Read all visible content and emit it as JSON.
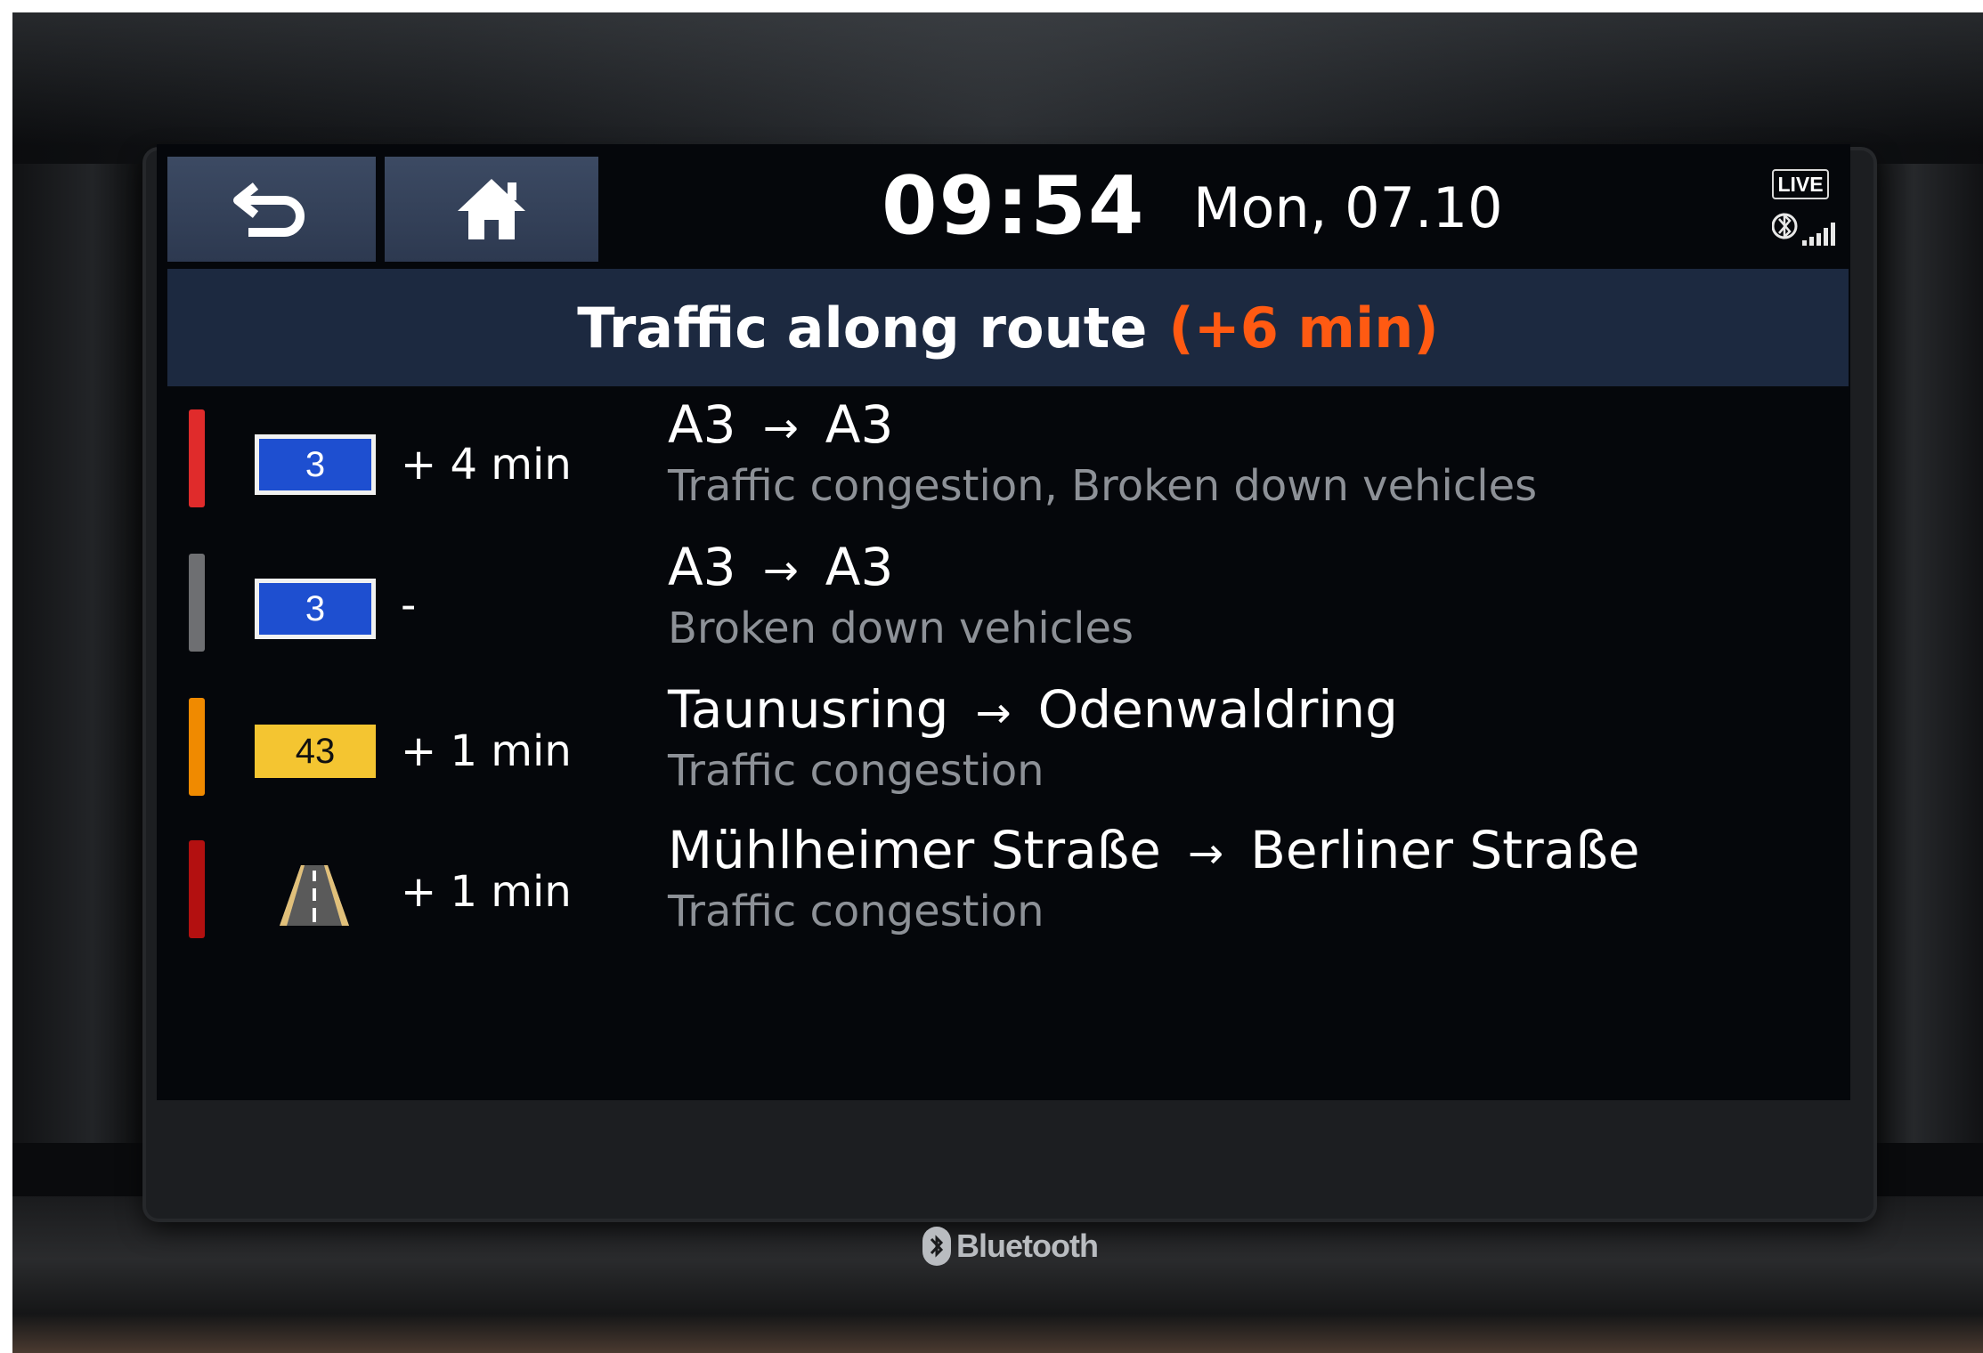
{
  "header": {
    "back_icon": "back-arrow-icon",
    "home_icon": "home-icon",
    "time": "09:54",
    "date": "Mon, 07.10",
    "live_badge": "LIVE",
    "status_icons": [
      "bluetooth-icon",
      "signal-strength-icon"
    ]
  },
  "title": {
    "label": "Traffic along route",
    "delay": "(+6 min)"
  },
  "colors": {
    "accent_delay": "#ff5a12",
    "title_bar": "#1c2940",
    "nav_button": "#34415a",
    "severity_red": "#e02b2b",
    "severity_gray": "#6e6f72",
    "severity_orange": "#f08a00",
    "severity_dark_red": "#b31010",
    "shield_blue": "#1e4fd0",
    "shield_yellow": "#f4c531"
  },
  "incidents": [
    {
      "severity": "red",
      "road_sign": "3",
      "road_sign_type": "motorway-shield-blue",
      "delay": "+ 4 min",
      "from": "A3",
      "arrow": "→",
      "to": "A3",
      "description": "Traffic congestion, Broken down vehicles"
    },
    {
      "severity": "gray",
      "road_sign": "3",
      "road_sign_type": "motorway-shield-blue",
      "delay": "-",
      "from": "A3",
      "arrow": "→",
      "to": "A3",
      "description": "Broken down vehicles"
    },
    {
      "severity": "orange",
      "road_sign": "43",
      "road_sign_type": "federal-road-shield-yellow",
      "delay": "+ 1 min",
      "from": "Taunusring",
      "arrow": "→",
      "to": "Odenwaldring",
      "description": "Traffic congestion"
    },
    {
      "severity": "dark-red",
      "road_sign": "",
      "road_sign_type": "road-icon",
      "delay": "+ 1 min",
      "from": "Mühlheimer Straße",
      "arrow": "→",
      "to": "Berliner Straße",
      "description": "Traffic congestion"
    }
  ],
  "bezel": {
    "brand_label": "Bluetooth",
    "brand_icon": "bluetooth-logo-icon"
  }
}
